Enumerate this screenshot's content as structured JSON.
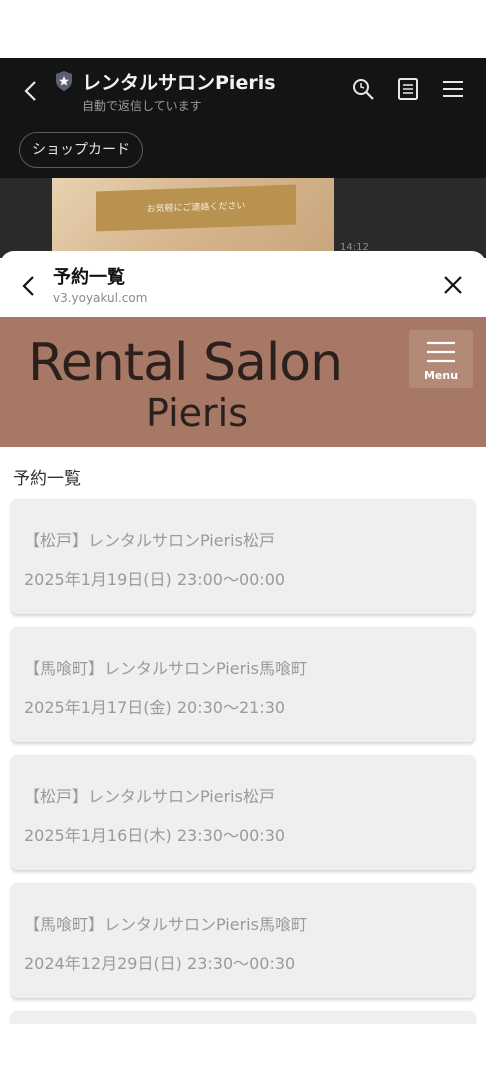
{
  "chat": {
    "title": "レンタルサロンPieris",
    "subtitle": "自動で返信しています",
    "shop_card_button": "ショップカード",
    "image_banner_text": "お気軽にご連絡ください",
    "message_time": "14:12",
    "icons": [
      "back-icon",
      "shield-star-icon",
      "search-icon",
      "notes-icon",
      "menu-icon"
    ]
  },
  "sheet": {
    "title": "予約一覧",
    "url": "v3.yoyakul.com",
    "icons": [
      "back-icon",
      "close-icon"
    ]
  },
  "brand": {
    "line1": "Rental Salon",
    "line2": "Pieris",
    "menu_label": "Menu",
    "background": "#a77866"
  },
  "list": {
    "heading": "予約一覧",
    "reservations": [
      {
        "shop": "【松戸】レンタルサロンPieris松戸",
        "datetime": "2025年1月19日(日) 23:00〜00:00"
      },
      {
        "shop": "【馬喰町】レンタルサロンPieris馬喰町",
        "datetime": "2025年1月17日(金) 20:30〜21:30"
      },
      {
        "shop": "【松戸】レンタルサロンPieris松戸",
        "datetime": "2025年1月16日(木) 23:30〜00:30"
      },
      {
        "shop": "【馬喰町】レンタルサロンPieris馬喰町",
        "datetime": "2024年12月29日(日) 23:30〜00:30"
      }
    ]
  }
}
